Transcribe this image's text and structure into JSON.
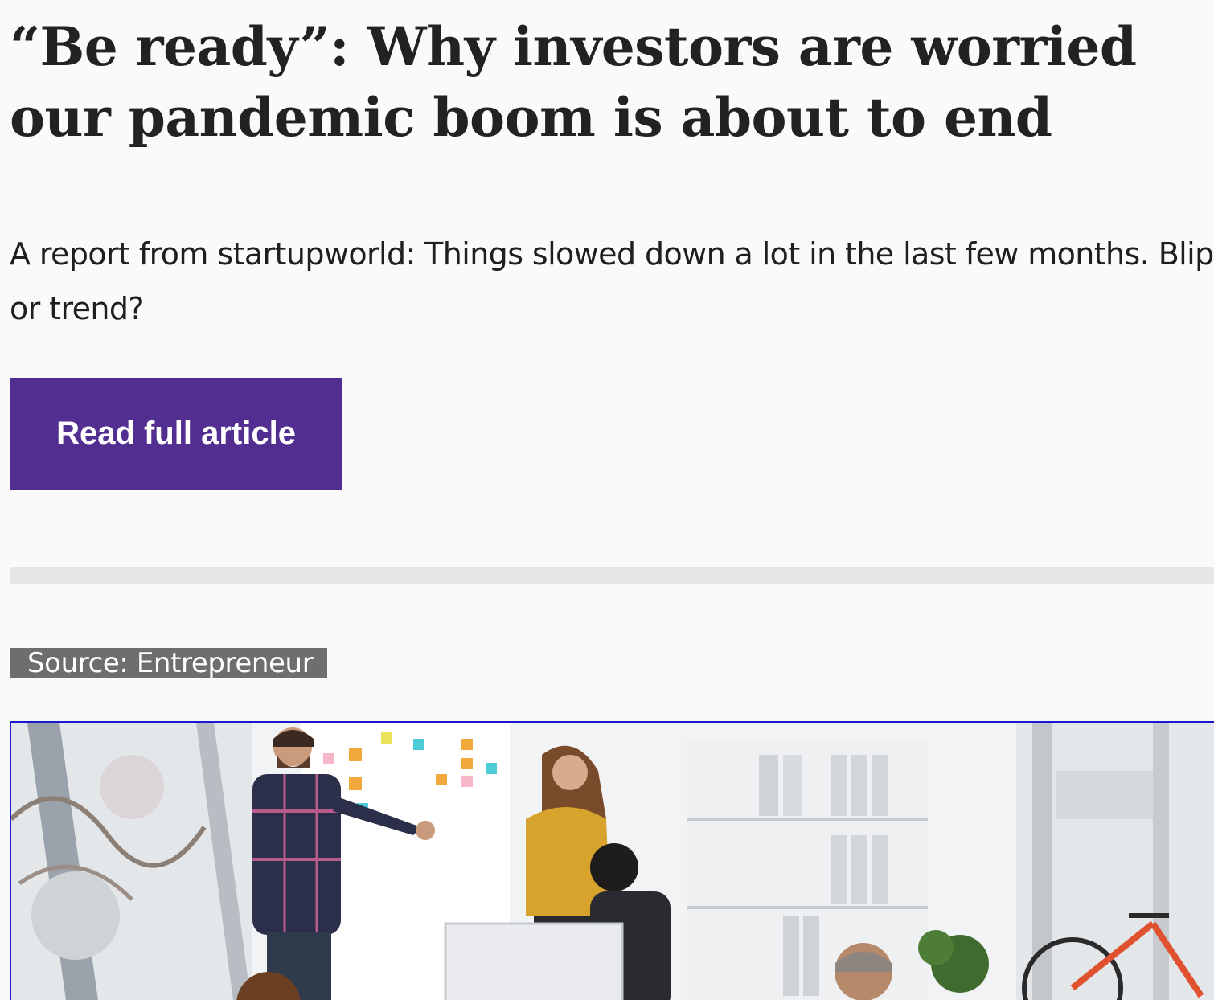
{
  "article": {
    "title": "“Be ready”: Why investors are worried our pandemic boom is about to end",
    "summary": "A report from startupworld: Things slowed down a lot in the last few months. Blip or trend?",
    "read_button_label": "Read full article",
    "source_label": "Source: Entrepreneur"
  },
  "image": {
    "description_icon": "office-photo"
  },
  "colors": {
    "button_bg": "#522e91",
    "badge_bg": "#6e6e6e",
    "divider": "#e6e6e6",
    "image_border": "#1a1acc"
  }
}
